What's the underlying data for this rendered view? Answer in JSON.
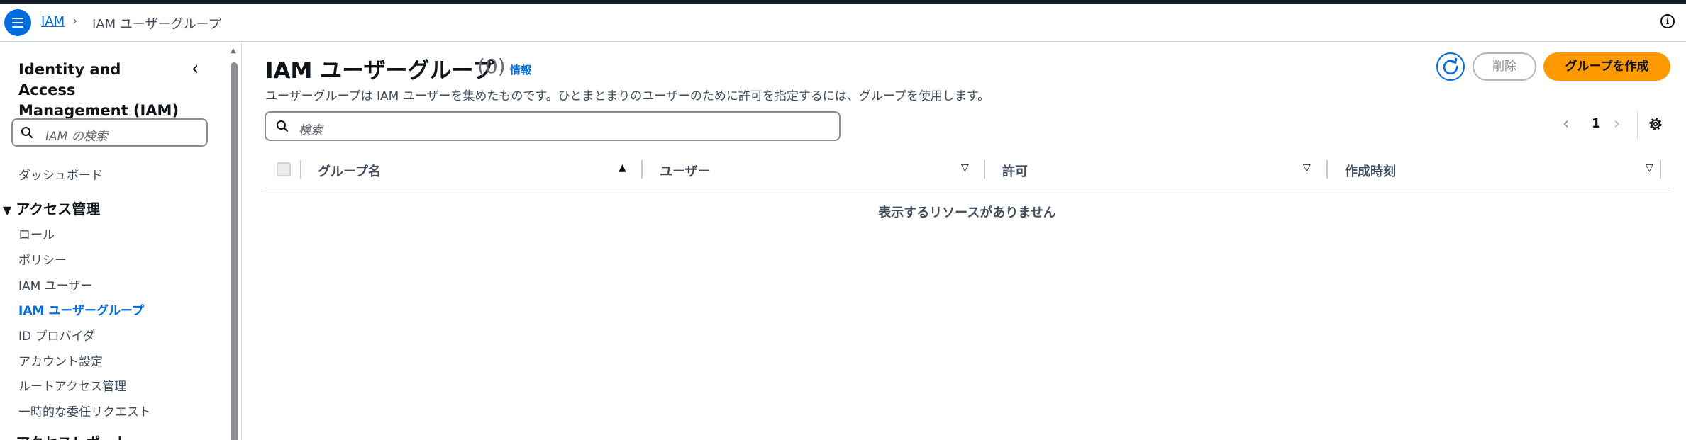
{
  "breadcrumb": {
    "root": "IAM",
    "separator": "›",
    "current": "IAM ユーザーグループ"
  },
  "sidebar": {
    "title": "Identity and Access Management (IAM)",
    "collapse": "‹",
    "search_placeholder": "IAM の検索",
    "dashboard": "ダッシュボード",
    "section_access": "アクセス管理",
    "items": [
      "ロール",
      "ポリシー",
      "IAM ユーザー",
      "IAM ユーザーグループ",
      "ID プロバイダ",
      "アカウント設定",
      "ルートアクセス管理",
      "一時的な委任リクエスト"
    ],
    "active_item": "IAM ユーザーグループ",
    "section_reports": "アクセスレポート"
  },
  "page": {
    "title": "IAM ユーザーグループ",
    "count": "(0)",
    "info": "情報",
    "description": "ユーザーグループは IAM ユーザーを集めたものです。ひとまとまりのユーザーのために許可を指定するには、グループを使用します。"
  },
  "actions": {
    "delete": "削除",
    "create": "グループを作成"
  },
  "search": {
    "placeholder": "検索"
  },
  "pagination": {
    "page": "1",
    "prev": "‹",
    "next": "›"
  },
  "table": {
    "columns": [
      "グループ名",
      "ユーザー",
      "許可",
      "作成時刻"
    ],
    "empty_message": "表示するリソースがありません"
  },
  "colors": {
    "accent": "#006ce0",
    "primary_button": "#ff9900",
    "topbar": "#161d26"
  }
}
